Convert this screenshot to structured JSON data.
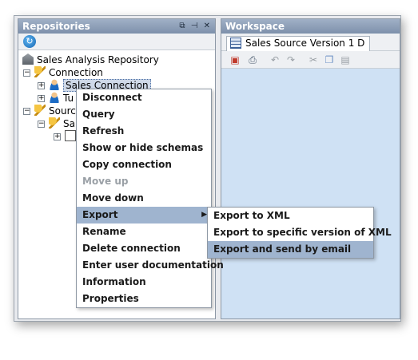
{
  "repositories": {
    "title": "Repositories",
    "window_controls": "⧉ ⊣ ✕",
    "refresh_icon": "refresh-icon",
    "tree": [
      {
        "label": "Sales Analysis Repository",
        "icon": "repository-icon"
      },
      {
        "label": "Connection",
        "icon": "connection-folder-icon"
      },
      {
        "label": "Sales Connection",
        "icon": "connection-user-icon",
        "selected": true
      },
      {
        "label": "Tu",
        "icon": "connection-user-icon"
      },
      {
        "label": "Sourc",
        "icon": "source-folder-icon"
      },
      {
        "label": "Sa",
        "icon": "source-icon"
      },
      {
        "label": "",
        "icon": "document-icon"
      }
    ]
  },
  "workspace": {
    "title": "Workspace",
    "tab_label": "Sales Source Version 1 D",
    "background_color": "#cfe1f4"
  },
  "context_menu": {
    "items": [
      {
        "label": "Disconnect",
        "enabled": true
      },
      {
        "label": "Query",
        "enabled": true
      },
      {
        "label": "Refresh",
        "enabled": true
      },
      {
        "label": "Show or hide schemas",
        "enabled": true
      },
      {
        "label": "Copy connection",
        "enabled": true
      },
      {
        "label": "Move up",
        "enabled": false
      },
      {
        "label": "Move down",
        "enabled": true
      },
      {
        "label": "Export",
        "enabled": true,
        "submenu": true,
        "highlighted": true
      },
      {
        "label": "Rename",
        "enabled": true
      },
      {
        "label": "Delete connection",
        "enabled": true
      },
      {
        "label": "Enter user documentation",
        "enabled": true
      },
      {
        "label": "Information",
        "enabled": true
      },
      {
        "label": "Properties",
        "enabled": true
      }
    ],
    "submenu_arrow": "▶"
  },
  "export_submenu": {
    "items": [
      {
        "label": "Export to XML",
        "highlighted": false
      },
      {
        "label": "Export to specific version of XML",
        "highlighted": false
      },
      {
        "label": "Export and send by email",
        "highlighted": true
      }
    ]
  },
  "colors": {
    "highlight": "#9fb4cf",
    "titlebar": "#8a9cb6"
  }
}
